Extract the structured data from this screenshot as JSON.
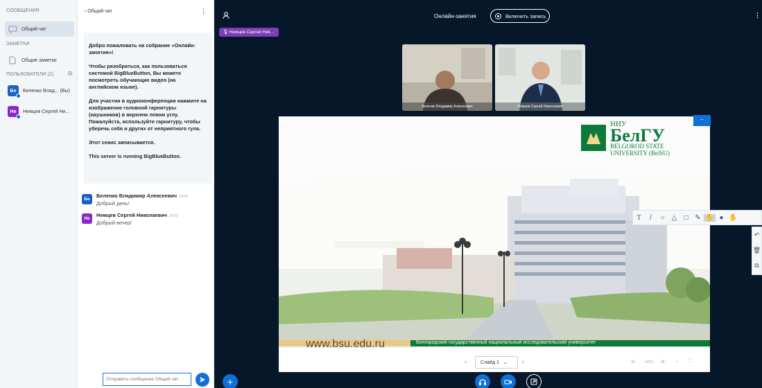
{
  "sidebar": {
    "messages_title": "СООБЩЕНИЯ",
    "public_chat": "Общий чат",
    "notes_title": "ЗАМЕТКИ",
    "shared_notes": "Общие заметки",
    "users_title": "ПОЛЬЗОВАТЕЛИ (2)",
    "users": [
      {
        "initials": "Бе",
        "name": "Беленко Влад... (Вы)",
        "color": "#1b60c5"
      },
      {
        "initials": "Не",
        "name": "Немцев Сергей Ни...",
        "color": "#8a27c8"
      }
    ]
  },
  "chat": {
    "back_label": "‹  Общий чат",
    "welcome": {
      "p1": "Добро пожаловать на собрание «Онлайн-занятия»!",
      "p2": "Чтобы разобраться, как пользоваться системой BigBlueButton, Вы можете посмотреть обучающие видео (на английском языке).",
      "p3": "Для участия в аудиоконференции нажмите на изображение головной гарнитуры (наушников) в верхнем левом углу. Пожалуйста, используйте гарнитуру, чтобы уберечь себя и других от неприятного гула.",
      "p4": "Этот сеанс записывается.",
      "p5": "This server is running BigBlueButton."
    },
    "messages": [
      {
        "initials": "Бе",
        "name": "Беленко Владимир Алексеевич",
        "time": "20:03",
        "text": "Добрый день!",
        "color": "#1b60c5"
      },
      {
        "initials": "Не",
        "name": "Немцев Сергей Николаевич",
        "time": "20:03",
        "text": "Добрый вечер!",
        "color": "#8a27c8"
      }
    ],
    "input_placeholder": "Отправить сообщение Общий чат"
  },
  "header": {
    "session_title": "Онлайн-занятия",
    "record_label": "Включить запись",
    "talking_indicator": "Немцев Сергей Ник..."
  },
  "videos": [
    {
      "name": "Беленко Владимир Алексеевич"
    },
    {
      "name": "Немцев Сергей Николаевич"
    }
  ],
  "slide": {
    "logo_abbr": "НИУ",
    "logo_main": "БелГУ",
    "logo_line1": "BELGOROD STATE",
    "logo_line2": "UNIVERSITY (BelSU)",
    "website": "www.bsu.edu.ru",
    "banner_text": "Белгородский государственный национальный исследовательский университет",
    "selector_label": "Слайд 1",
    "zoom_label": "100%"
  }
}
